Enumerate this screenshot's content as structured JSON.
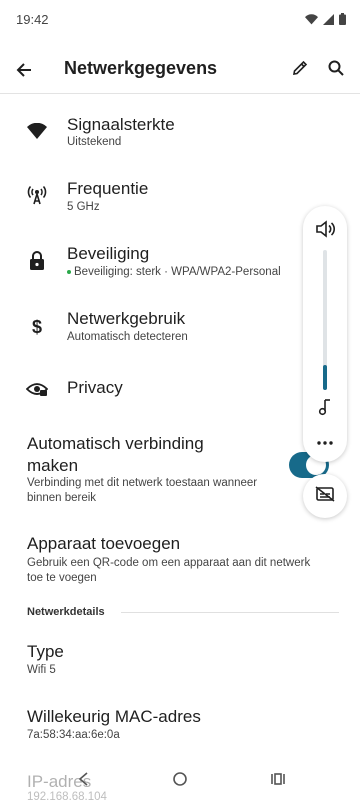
{
  "status_bar": {
    "time": "19:42"
  },
  "app_bar": {
    "title": "Netwerkgegevens"
  },
  "rows": [
    {
      "title": "Signaalsterkte",
      "subtitle": "Uitstekend"
    },
    {
      "title": "Frequentie",
      "subtitle": "5 GHz"
    },
    {
      "title": "Beveiliging",
      "subtitle": "Beveiliging: sterk · WPA/WPA2-Personal"
    },
    {
      "title": "Netwerkgebruik",
      "subtitle": "Automatisch detecteren"
    },
    {
      "title": "Privacy"
    }
  ],
  "auto_connect": {
    "title": "Automatisch verbinding maken",
    "subtitle": "Verbinding met dit netwerk toestaan wanneer binnen bereik",
    "enabled": true
  },
  "add_device": {
    "title": "Apparaat toevoegen",
    "subtitle": "Gebruik een QR-code om een apparaat aan dit netwerk toe te voegen"
  },
  "section_label": "Netwerkdetails",
  "details": [
    {
      "title": "Type",
      "value": "Wifi 5"
    },
    {
      "title": "Willekeurig MAC-adres",
      "value": "7a:58:34:aa:6e:0a"
    },
    {
      "title": "IP-adres",
      "value": "192.168.68.104"
    }
  ],
  "volume_panel": {
    "level": 0.18
  },
  "colors": {
    "accent": "#176a8a",
    "security_dot": "#2aa84a"
  },
  "icons": [
    "wifi-icon",
    "frequency-icon",
    "lock-icon",
    "dollar-icon",
    "privacy-eye-icon",
    "speaker-icon",
    "music-note-icon",
    "more-icon",
    "captions-off-icon"
  ]
}
